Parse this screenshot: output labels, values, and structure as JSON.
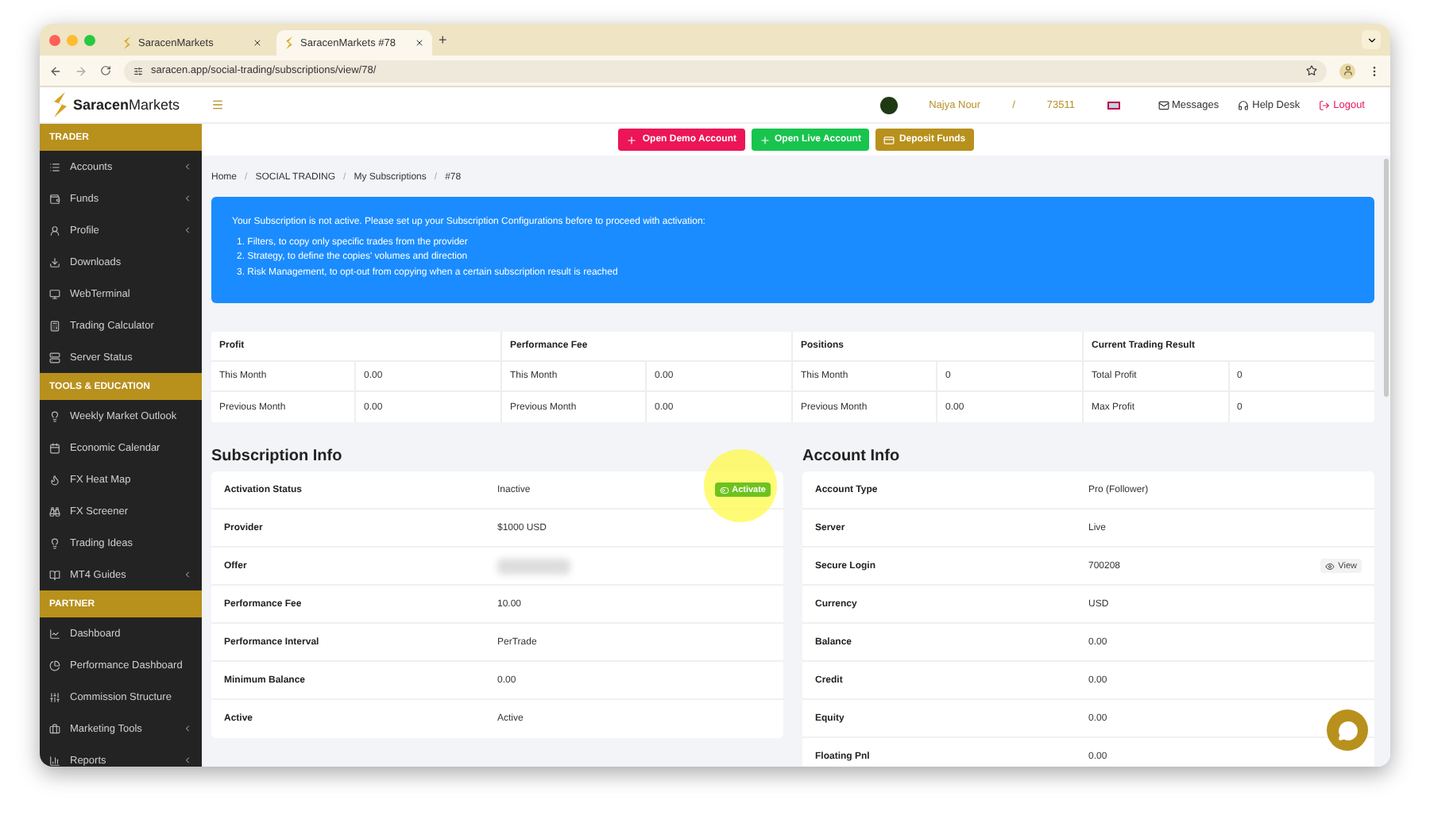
{
  "browser": {
    "tabs": [
      {
        "title": "SaracenMarkets",
        "selected": false
      },
      {
        "title": "SaracenMarkets #78",
        "selected": true
      }
    ],
    "new_tab": "+",
    "url": "saracen.app/social-trading/subscriptions/view/78/"
  },
  "header": {
    "brand_bold": "Saracen",
    "brand_light": "Markets",
    "user": "Najya Nour",
    "separator": "/",
    "account": "73511",
    "links": [
      {
        "label": "Messages",
        "kind": "messages"
      },
      {
        "label": "Help Desk",
        "kind": "help"
      },
      {
        "label": "Logout",
        "kind": "logout"
      }
    ]
  },
  "actions": [
    {
      "label": "Open Demo Account",
      "kind": "demo"
    },
    {
      "label": "Open Live Account",
      "kind": "live"
    },
    {
      "label": "Deposit Funds",
      "kind": "deposit"
    }
  ],
  "sidebar": {
    "sections": [
      {
        "title": "TRADER",
        "items": [
          {
            "label": "Accounts",
            "expandable": true
          },
          {
            "label": "Funds",
            "expandable": true
          },
          {
            "label": "Profile",
            "expandable": true
          },
          {
            "label": "Downloads",
            "expandable": false
          },
          {
            "label": "WebTerminal",
            "expandable": false
          },
          {
            "label": "Trading Calculator",
            "expandable": false
          },
          {
            "label": "Server Status",
            "expandable": false
          }
        ]
      },
      {
        "title": "TOOLS & EDUCATION",
        "items": [
          {
            "label": "Weekly Market Outlook",
            "expandable": false
          },
          {
            "label": "Economic Calendar",
            "expandable": false
          },
          {
            "label": "FX Heat Map",
            "expandable": false
          },
          {
            "label": "FX Screener",
            "expandable": false
          },
          {
            "label": "Trading Ideas",
            "expandable": false
          },
          {
            "label": "MT4 Guides",
            "expandable": true
          }
        ]
      },
      {
        "title": "PARTNER",
        "items": [
          {
            "label": "Dashboard",
            "expandable": false
          },
          {
            "label": "Performance Dashboard",
            "expandable": false
          },
          {
            "label": "Commission Structure",
            "expandable": false
          },
          {
            "label": "Marketing Tools",
            "expandable": true
          },
          {
            "label": "Reports",
            "expandable": true
          }
        ]
      }
    ]
  },
  "breadcrumb": [
    "Home",
    "SOCIAL TRADING",
    "My Subscriptions",
    "#78"
  ],
  "breadcrumb_separator": "/",
  "alert": {
    "message": "Your Subscription is not active. Please set up your Subscription Configurations before to proceed with activation:",
    "steps": [
      "1. Filters, to copy only specific trades from the provider",
      "2. Strategy, to define the copies' volumes and direction",
      "3. Risk Management, to opt-out from copying when a certain subscription result is reached"
    ]
  },
  "stats": [
    {
      "title": "Profit",
      "rows": [
        {
          "label": "This Month",
          "value": "0.00"
        },
        {
          "label": "Previous Month",
          "value": "0.00"
        }
      ]
    },
    {
      "title": "Performance Fee",
      "rows": [
        {
          "label": "This Month",
          "value": "0.00"
        },
        {
          "label": "Previous Month",
          "value": "0.00"
        }
      ]
    },
    {
      "title": "Positions",
      "rows": [
        {
          "label": "This Month",
          "value": "0"
        },
        {
          "label": "Previous Month",
          "value": "0.00"
        }
      ]
    },
    {
      "title": "Current Trading Result",
      "rows": [
        {
          "label": "Total Profit",
          "value": "0"
        },
        {
          "label": "Max Profit",
          "value": "0"
        }
      ]
    }
  ],
  "subscription_info": {
    "title": "Subscription Info",
    "rows": [
      {
        "label": "Activation Status",
        "value": "Inactive",
        "action": "Activate",
        "kind": "text"
      },
      {
        "label": "Provider",
        "value": "$1000 USD",
        "kind": "text"
      },
      {
        "label": "Offer",
        "kind": "blurred"
      },
      {
        "label": "Performance Fee",
        "value": "10.00",
        "kind": "text"
      },
      {
        "label": "Performance Interval",
        "value": "PerTrade",
        "kind": "text"
      },
      {
        "label": "Minimum Balance",
        "value": "0.00",
        "kind": "text"
      },
      {
        "label": "Active",
        "value": "Active",
        "kind": "text"
      }
    ]
  },
  "account_info": {
    "title": "Account Info",
    "rows": [
      {
        "label": "Account Type",
        "value": "Pro (Follower)",
        "kind": "text"
      },
      {
        "label": "Server",
        "value": "Live",
        "kind": "text"
      },
      {
        "label": "Secure Login",
        "value": "700208",
        "action": "View",
        "kind": "text"
      },
      {
        "label": "Currency",
        "value": "USD",
        "kind": "text"
      },
      {
        "label": "Balance",
        "value": "0.00",
        "kind": "text"
      },
      {
        "label": "Credit",
        "value": "0.00",
        "kind": "text"
      },
      {
        "label": "Equity",
        "value": "0.00",
        "kind": "text"
      },
      {
        "label": "Floating Pnl",
        "value": "0.00",
        "kind": "text"
      }
    ]
  }
}
